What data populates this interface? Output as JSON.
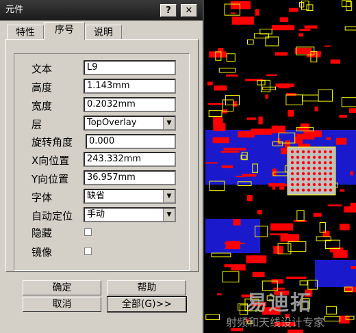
{
  "window": {
    "title": "元件",
    "help_label": "?",
    "close_label": "✕"
  },
  "tabs": [
    {
      "label": "特性",
      "active": false
    },
    {
      "label": "序号",
      "active": true
    },
    {
      "label": "说明",
      "active": false
    }
  ],
  "fields": {
    "text": {
      "label": "文本",
      "value": "L9"
    },
    "height": {
      "label": "高度",
      "value": "1.143mm"
    },
    "width": {
      "label": "宽度",
      "value": "0.2032mm"
    },
    "layer": {
      "label": "层",
      "value": "TopOverlay"
    },
    "rotation": {
      "label": "旋转角度",
      "value": "0.000"
    },
    "x_pos": {
      "label": "X向位置",
      "value": "243.332mm"
    },
    "y_pos": {
      "label": "Y向位置",
      "value": "36.957mm"
    },
    "font": {
      "label": "字体",
      "value": "缺省"
    },
    "auto_position": {
      "label": "自动定位",
      "value": "手动"
    },
    "hidden": {
      "label": "隐藏",
      "checked": false
    },
    "mirror": {
      "label": "镜像",
      "checked": false
    }
  },
  "buttons": {
    "ok": "确定",
    "help": "帮助",
    "cancel": "取消",
    "all": "全部(G)>>"
  },
  "watermark": {
    "line1": "易迪拓",
    "line2": "射频和天线设计专家"
  },
  "colors": {
    "pcb_bg": "#000000",
    "top_layer": "#ff0000",
    "bottom_layer": "#2020ff",
    "silk": "#ffff00",
    "dialog": "#d4d0c8"
  }
}
